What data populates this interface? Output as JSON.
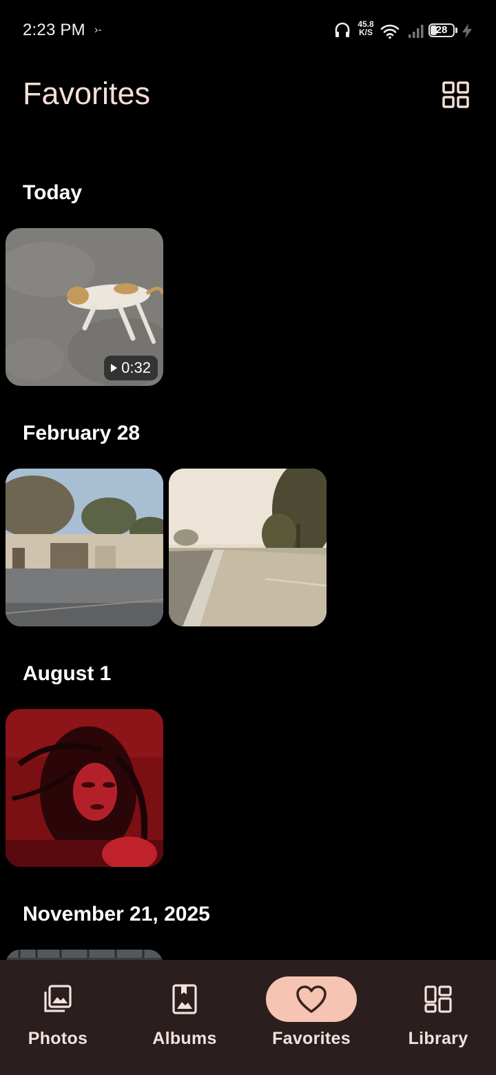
{
  "status_bar": {
    "time": "2:23 PM",
    "extra": "›-",
    "net_speed_value": "45.8",
    "net_speed_unit": "K/S",
    "battery": "28",
    "icons": [
      "headphones-icon",
      "wifi-icon",
      "signal-icon",
      "battery-icon",
      "charging-icon"
    ]
  },
  "header": {
    "title": "Favorites",
    "grid_icon": "grid-view-icon"
  },
  "sections": [
    {
      "title": "Today",
      "items": [
        {
          "type": "video",
          "duration": "0:32",
          "subject": "cat on pavement"
        }
      ]
    },
    {
      "title": "February 28",
      "items": [
        {
          "type": "photo",
          "subject": "street with wall"
        },
        {
          "type": "photo",
          "subject": "road with trees"
        }
      ]
    },
    {
      "title": "August 1",
      "items": [
        {
          "type": "photo",
          "subject": "red portrait"
        }
      ]
    },
    {
      "title": "November 21, 2025",
      "items": [
        {
          "type": "photo",
          "subject": "partially visible"
        }
      ]
    }
  ],
  "bottom_nav": {
    "items": [
      {
        "label": "Photos",
        "icon": "photos-icon",
        "active": false
      },
      {
        "label": "Albums",
        "icon": "albums-icon",
        "active": false
      },
      {
        "label": "Favorites",
        "icon": "heart-icon",
        "active": true
      },
      {
        "label": "Library",
        "icon": "library-icon",
        "active": false
      }
    ]
  },
  "colors": {
    "background": "#000000",
    "title": "#f6ded7",
    "nav_background": "#2a1f1e",
    "nav_active_pill": "#f6c4b2"
  }
}
